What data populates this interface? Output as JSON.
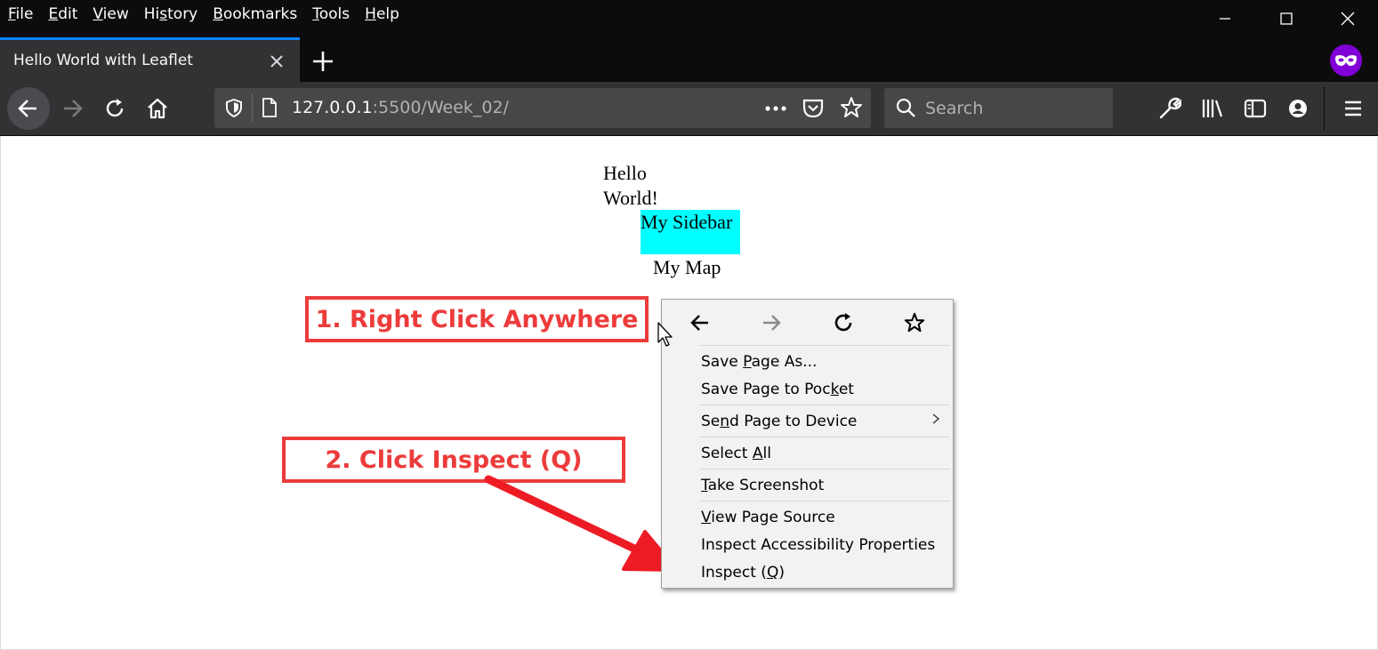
{
  "menubar": {
    "items": [
      {
        "pre": "",
        "ul": "F",
        "post": "ile"
      },
      {
        "pre": "",
        "ul": "E",
        "post": "dit"
      },
      {
        "pre": "",
        "ul": "V",
        "post": "iew"
      },
      {
        "pre": "Hi",
        "ul": "s",
        "post": "tory"
      },
      {
        "pre": "",
        "ul": "B",
        "post": "ookmarks"
      },
      {
        "pre": "",
        "ul": "T",
        "post": "ools"
      },
      {
        "pre": "",
        "ul": "H",
        "post": "elp"
      }
    ]
  },
  "window_controls": [
    "minimize-icon",
    "maximize-icon",
    "close-icon"
  ],
  "tab": {
    "title": "Hello World with Leaflet"
  },
  "urlbar": {
    "host": "127.0.0.1",
    "rest": ":5500/Week_02/"
  },
  "searchbar": {
    "placeholder": "Search"
  },
  "page": {
    "hello": "Hello World!",
    "sidebar": "My Sidebar",
    "map": "My Map"
  },
  "annotations": {
    "step1": "1. Right Click Anywhere",
    "step2": "2. Click Inspect (Q)"
  },
  "context_menu": {
    "items": [
      {
        "pre": "Save ",
        "ul": "P",
        "post": "age As..."
      },
      {
        "pre": "Save Page to Poc",
        "ul": "k",
        "post": "et"
      },
      {
        "pre": "Se",
        "ul": "n",
        "post": "d Page to Device"
      },
      {
        "pre": "Select ",
        "ul": "A",
        "post": "ll"
      },
      {
        "pre": "",
        "ul": "T",
        "post": "ake Screenshot"
      },
      {
        "pre": "",
        "ul": "V",
        "post": "iew Page Source"
      },
      {
        "pre": "Inspect Accessibility Properties",
        "ul": "",
        "post": ""
      },
      {
        "pre": "Inspect (",
        "ul": "Q",
        "post": ")"
      }
    ]
  },
  "colors": {
    "annotation_red": "#ed3b3b",
    "sidebar_cyan": "#00ffff",
    "tab_accent": "#0a84ff",
    "private_badge": "#8000d7"
  }
}
